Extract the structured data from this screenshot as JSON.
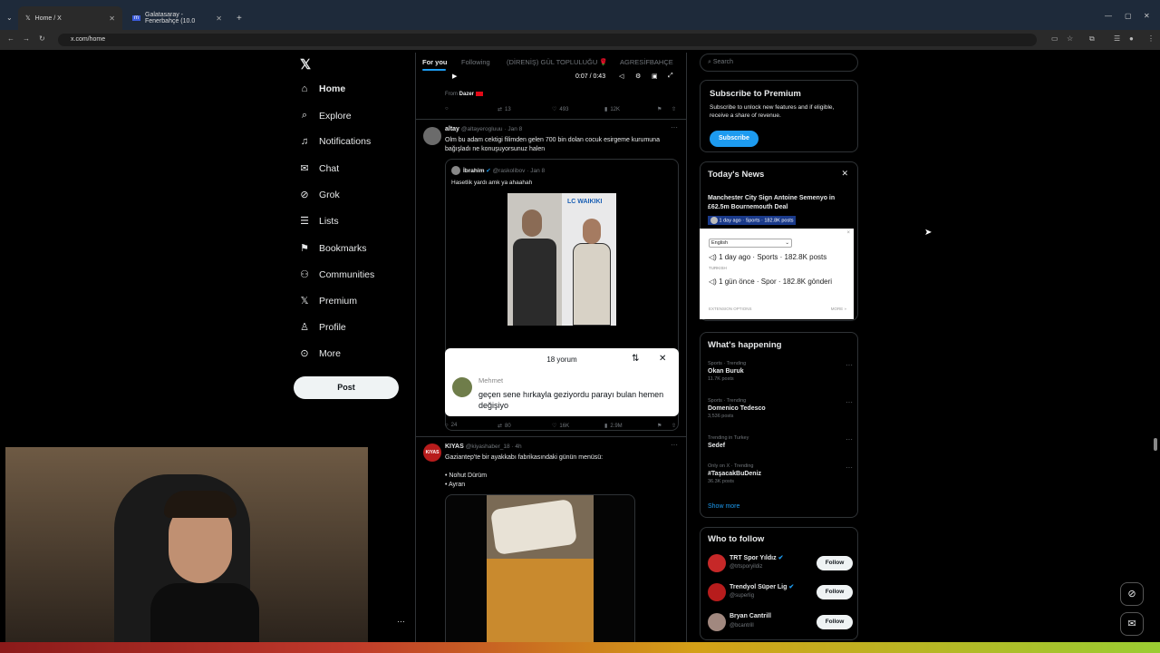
{
  "browser": {
    "tabs": [
      {
        "title": "Home / X"
      },
      {
        "title": "Galatasaray - Fenerbahçe (10.0"
      }
    ],
    "url": "x.com/home"
  },
  "sidebar": {
    "items": [
      {
        "label": "Home",
        "icon": "home-icon"
      },
      {
        "label": "Explore",
        "icon": "search-icon"
      },
      {
        "label": "Notifications",
        "icon": "bell-icon"
      },
      {
        "label": "Chat",
        "icon": "mail-icon"
      },
      {
        "label": "Grok",
        "icon": "grok-icon"
      },
      {
        "label": "Lists",
        "icon": "list-icon"
      },
      {
        "label": "Bookmarks",
        "icon": "bookmark-icon"
      },
      {
        "label": "Communities",
        "icon": "communities-icon"
      },
      {
        "label": "Premium",
        "icon": "x-icon"
      },
      {
        "label": "Profile",
        "icon": "person-icon"
      },
      {
        "label": "More",
        "icon": "more-circle-icon"
      }
    ],
    "post_label": "Post"
  },
  "feed": {
    "tabs": [
      "For you",
      "Following",
      "(DİRENİŞ) GÜL TOPLULUĞU 🌹",
      "AGRESİFBAHÇE"
    ],
    "video_time": "0:07 / 0:43",
    "from_label": "From",
    "from_name": "Dazer",
    "t1_actions": {
      "retweets": "13",
      "likes": "493",
      "views": "12K"
    },
    "tweet2": {
      "name": "altay",
      "handle": "@altayerogluuu · Jan 8",
      "text": "Olm bu adam cektigi filimden gelen 700 bin dolan cocuk esirgeme kurumuna bağışladı ne konuşuyorsunuz halen",
      "quote_name": "İbrahim",
      "quote_handle": "@raskolibov · Jan 8",
      "quote_text": "Hasetlik yardı amk ya ahaahah",
      "photo_brand": "LC WAIKIKI",
      "comment_count": "18 yorum",
      "comment_user": "Mehmet",
      "comment_text": "geçen sene hırkayla geziyordu parayı bulan hemen değişiyo",
      "actions": {
        "replies": "24",
        "retweets": "80",
        "likes": "16K",
        "views": "2.9M"
      }
    },
    "tweet3": {
      "avatar_text": "KIYAS",
      "name": "KIYAS",
      "handle": "@kiyashaber_18 · 4h",
      "line1": "Gaziantep'te bir ayakkabı fabrikasındaki günün menüsü:",
      "line2": "• Nohut Dürüm",
      "line3": "• Ayran"
    }
  },
  "right": {
    "search_placeholder": "Search",
    "premium": {
      "title": "Subscribe to Premium",
      "text": "Subscribe to unlock new features and if eligible, receive a share of revenue.",
      "button": "Subscribe"
    },
    "news": {
      "title": "Today's News",
      "headline": "Manchester City Sign Antoine Semenyo in £62.5m Bournemouth Deal",
      "meta": "1 day ago · Sports · 182.8K posts"
    },
    "translate_popup": {
      "language": "English",
      "line_en": "1 day ago · Sports · 182.8K posts",
      "label_tr": "TURKISH",
      "line_tr": "1 gün önce · Spor · 182.8K gönderi",
      "ext_options": "EXTENSION OPTIONS",
      "more": "MORE »"
    },
    "happening": {
      "title": "What's happening",
      "trends": [
        {
          "meta": "Sports · Trending",
          "name": "Okan Buruk",
          "count": "11.7K posts"
        },
        {
          "meta": "Sports · Trending",
          "name": "Domenico Tedesco",
          "count": "3,536 posts"
        },
        {
          "meta": "Trending in Turkey",
          "name": "Sedef",
          "count": ""
        },
        {
          "meta": "Only on X · Trending",
          "name": "#TaşacakBuDeniz",
          "count": "36.3K posts"
        }
      ],
      "show_more": "Show more"
    },
    "who_to_follow": {
      "title": "Who to follow",
      "accounts": [
        {
          "name": "TRT Spor Yıldız",
          "handle": "@trtsporyildiz",
          "button": "Follow"
        },
        {
          "name": "Trendyol Süper Lig",
          "handle": "@superlig",
          "button": "Follow"
        },
        {
          "name": "Bryan Cantrill",
          "handle": "@bcantrill",
          "button": "Follow"
        }
      ]
    }
  }
}
